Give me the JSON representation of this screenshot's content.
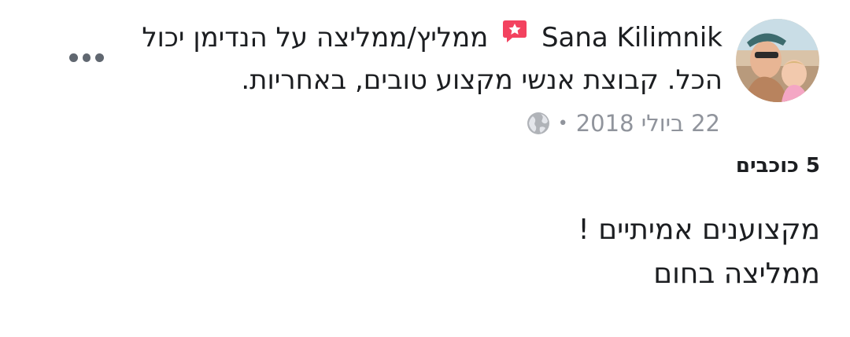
{
  "post": {
    "author": "Sana Kilimnik",
    "action_text": "ממליץ/ממליצה על הנדימן יכול הכל.  קבוצת אנשי מקצוע טובים, באחריות.",
    "date": "22 ביולי 2018",
    "separator": "•",
    "privacy_icon": "globe-icon",
    "recommend_icon": "recommendation-star-icon",
    "rating": "5 כוכבים",
    "review_lines": [
      "מקצוענים אמיתיים !",
      "ממליצה בחום"
    ]
  },
  "colors": {
    "recommend_badge": "#f3425f",
    "meta_text": "#90949c",
    "more_dots": "#606770"
  }
}
